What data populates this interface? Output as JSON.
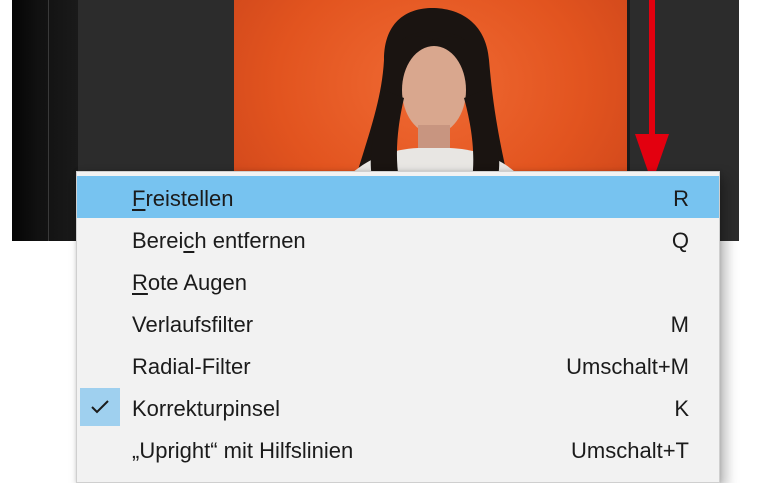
{
  "app": {
    "photo_description_icon": "portrait-photo"
  },
  "annotation": {
    "arrow_color": "#e3000f",
    "arrow_icon": "down-arrow-icon"
  },
  "menu": {
    "items": [
      {
        "label_pre": "",
        "label_ul": "F",
        "label_post": "reistellen",
        "shortcut": "R",
        "highlighted": true,
        "checked": false
      },
      {
        "label_pre": "Berei",
        "label_ul": "c",
        "label_post": "h entfernen",
        "shortcut": "Q",
        "highlighted": false,
        "checked": false
      },
      {
        "label_pre": "",
        "label_ul": "R",
        "label_post": "ote Augen",
        "shortcut": "",
        "highlighted": false,
        "checked": false
      },
      {
        "label_pre": "Verlaufsfilter",
        "label_ul": "",
        "label_post": "",
        "shortcut": "M",
        "highlighted": false,
        "checked": false
      },
      {
        "label_pre": "Radial-Filter",
        "label_ul": "",
        "label_post": "",
        "shortcut": "Umschalt+M",
        "highlighted": false,
        "checked": false
      },
      {
        "label_pre": "Korrekturpinsel",
        "label_ul": "",
        "label_post": "",
        "shortcut": "K",
        "highlighted": false,
        "checked": true
      },
      {
        "label_pre": "„Upright“ mit Hilfslinien",
        "label_ul": "",
        "label_post": "",
        "shortcut": "Umschalt+T",
        "highlighted": false,
        "checked": false
      }
    ],
    "highlight_color": "#77c3f0"
  }
}
